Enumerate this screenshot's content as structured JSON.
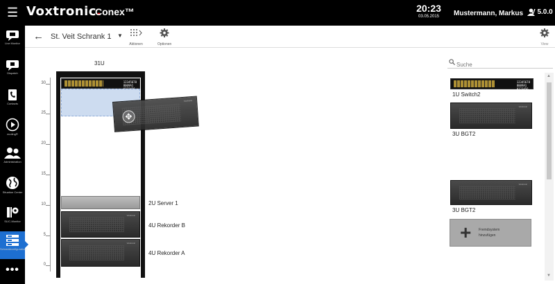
{
  "header": {
    "brand_name": "Voxtronic",
    "brand_dot": ".",
    "product": "Conex™",
    "time": "20:23",
    "date": "03.05.2015",
    "user": "Mustermann, Markus",
    "version": "V 5.0.0"
  },
  "sidebar": {
    "items": [
      {
        "label": "Live Monitor",
        "icon": "speech-bubble-icon"
      },
      {
        "label": "Dispatch",
        "icon": "dispatch-icon"
      },
      {
        "label": "Contacts",
        "icon": "phone-book-icon"
      },
      {
        "label": "ecoling®",
        "icon": "play-icon"
      },
      {
        "label": "Administration",
        "icon": "users-icon"
      },
      {
        "label": "Situation Center",
        "icon": "globe-icon"
      },
      {
        "label": "SLIC-Monitor",
        "icon": "gear-server-icon"
      },
      {
        "label": "Schrankkonfiguration",
        "icon": "server-rack-icon",
        "active": true
      }
    ],
    "more": "•••"
  },
  "toolbar": {
    "cabinet_name": "St. Veit Schrank 1",
    "actions_label": "Aktionen",
    "options_label": "Optionen",
    "view_label": "View"
  },
  "rack": {
    "height_label": "31U",
    "ruler_ticks": [
      "30",
      "25",
      "20",
      "15",
      "10",
      "5",
      "0"
    ],
    "devices": [
      {
        "label": "2U Server 1"
      },
      {
        "label": "4U Rekorder B"
      },
      {
        "label": "4U  Rekorder A"
      }
    ],
    "switch_text": [
      "12345678",
      "8009A1",
      "0123456"
    ],
    "switch_brand": "Voxtronic",
    "device_brand": "Voxtronic"
  },
  "library": {
    "search_placeholder": "Suche",
    "items": [
      {
        "label": "1U  Switch2"
      },
      {
        "label": "3U  BGT2"
      },
      {
        "label": "3U  BGT2"
      }
    ],
    "add_button_line1": "Fremdsystem",
    "add_button_line2": "hinzufügen"
  },
  "colors": {
    "topbar": "#000000",
    "accent": "#1d6fd1",
    "brand_dot": "#e8222a",
    "drop_zone": "#cddcf0"
  }
}
